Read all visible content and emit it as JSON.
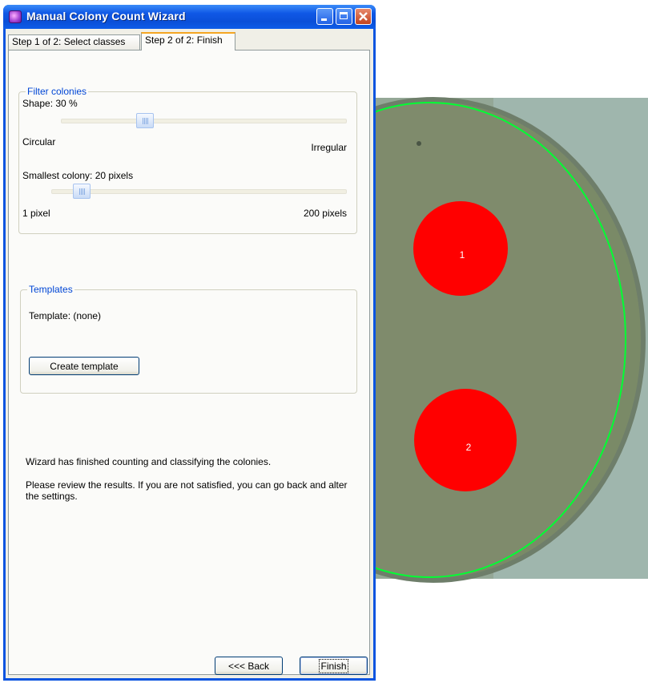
{
  "window": {
    "title": "Manual Colony Count Wizard",
    "tabs": [
      {
        "label": "Step 1 of 2: Select classes",
        "selected": false
      },
      {
        "label": "Step 2 of 2: Finish",
        "selected": true
      }
    ]
  },
  "filter_colonies": {
    "title": "Filter colonies",
    "shape_label": "Shape: 30 %",
    "shape_value_percent": 30,
    "shape_min_label": "Circular",
    "shape_max_label": "Irregular",
    "size_label": "Smallest colony: 20 pixels",
    "size_value": 20,
    "size_min_label": "1 pixel",
    "size_max_label": "200 pixels"
  },
  "templates": {
    "title": "Templates",
    "template_label": "Template: (none)",
    "create_button": "Create template"
  },
  "messages": {
    "finished": "Wizard has finished counting and classifying the colonies.",
    "review": "Please review the results. If you are not satisfied, you can go back and alter the settings."
  },
  "buttons": {
    "back": "<<< Back",
    "finish": "Finish"
  },
  "plate": {
    "colonies": [
      {
        "label": "1"
      },
      {
        "label": "2"
      }
    ],
    "colors": {
      "colony": "#ff0000",
      "plate_outline": "#00ff33",
      "agar": "#7f8b6c",
      "background": "#9fb6ad"
    }
  }
}
